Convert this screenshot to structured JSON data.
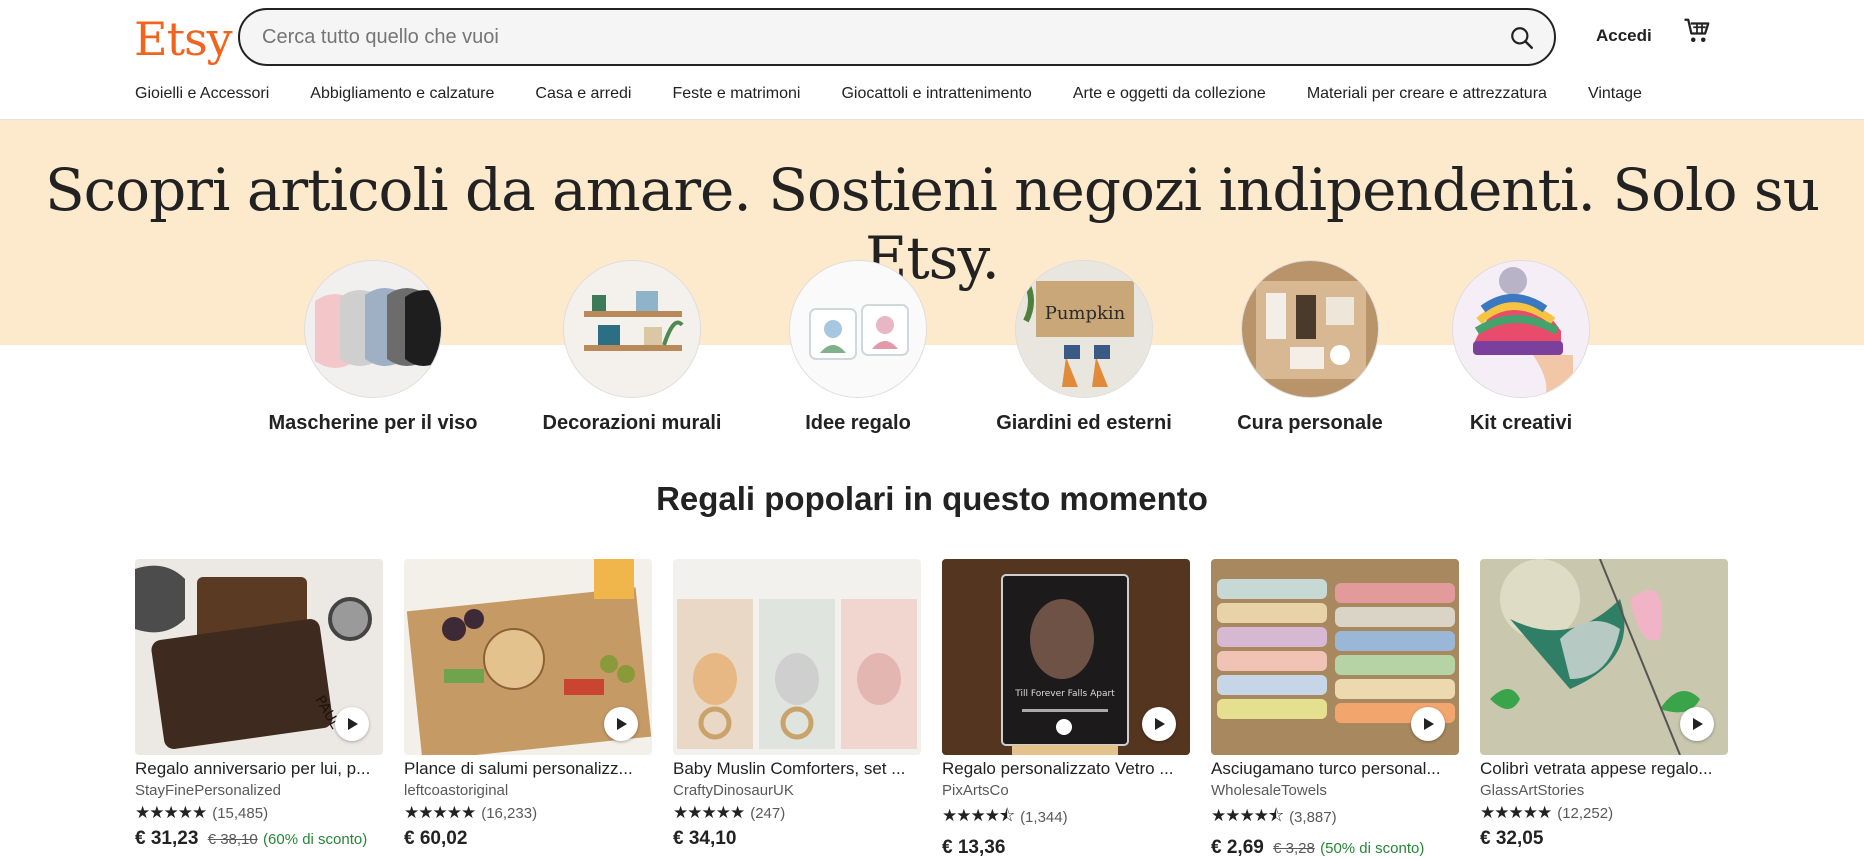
{
  "header": {
    "logo": "Etsy",
    "search_placeholder": "Cerca tutto quello che vuoi",
    "signin_label": "Accedi",
    "search_icon": "search-icon",
    "cart_icon": "cart-icon",
    "brand_color": "#F1641E"
  },
  "nav": {
    "items": [
      "Gioielli e Accessori",
      "Abbigliamento e calzature",
      "Casa e arredi",
      "Feste e matrimoni",
      "Giocattoli e intrattenimento",
      "Arte e oggetti da collezione",
      "Materiali per creare e attrezzatura",
      "Vintage"
    ]
  },
  "hero": {
    "title": "Scopri articoli da amare. Sostieni negozi indipendenti. Solo su Etsy.",
    "background": "#fde9cc"
  },
  "categories": [
    {
      "label": "Mascherine per il viso"
    },
    {
      "label": "Decorazioni murali"
    },
    {
      "label": "Idee regalo"
    },
    {
      "label": "Giardini ed esterni"
    },
    {
      "label": "Cura personale"
    },
    {
      "label": "Kit creativi"
    }
  ],
  "section": {
    "title": "Regali popolari in questo momento"
  },
  "products": [
    {
      "title": "Regalo anniversario per lui, p...",
      "shop": "StayFinePersonalized",
      "stars": "★★★★★",
      "reviews": "(15,485)",
      "price": "€ 31,23",
      "old_price": "€ 38,10",
      "discount": "(60% di sconto)"
    },
    {
      "title": "Plance di salumi personalizz...",
      "shop": "leftcoastoriginal",
      "stars": "★★★★★",
      "reviews": "(16,233)",
      "price": "€ 60,02",
      "old_price": "",
      "discount": ""
    },
    {
      "title": "Baby Muslin Comforters, set ...",
      "shop": "CraftyDinosaurUK",
      "stars": "★★★★★",
      "reviews": "(247)",
      "price": "€ 34,10",
      "old_price": "",
      "discount": ""
    },
    {
      "title": "Regalo personalizzato Vetro ...",
      "shop": "PixArtsCo",
      "stars": "★★★★⯪",
      "reviews": "(1,344)",
      "price": "€ 13,36",
      "old_price": "",
      "discount": ""
    },
    {
      "title": "Asciugamano turco personal...",
      "shop": "WholesaleTowels",
      "stars": "★★★★⯪",
      "reviews": "(3,887)",
      "price": "€ 2,69",
      "old_price": "€ 3,28",
      "discount": "(50% di sconto)"
    },
    {
      "title": "Colibrì vetrata appese regalo...",
      "shop": "GlassArtStories",
      "stars": "★★★★★",
      "reviews": "(12,252)",
      "price": "€ 32,05",
      "old_price": "",
      "discount": ""
    }
  ]
}
